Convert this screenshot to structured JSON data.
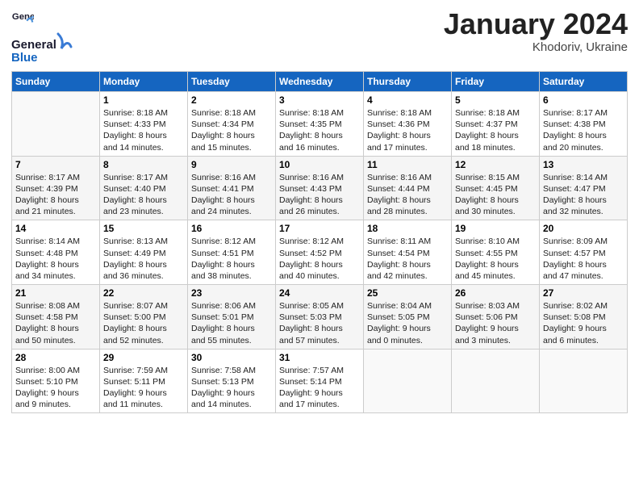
{
  "header": {
    "logo_general": "General",
    "logo_blue": "Blue",
    "month": "January 2024",
    "location": "Khodoriv, Ukraine"
  },
  "weekdays": [
    "Sunday",
    "Monday",
    "Tuesday",
    "Wednesday",
    "Thursday",
    "Friday",
    "Saturday"
  ],
  "weeks": [
    [
      {
        "day": "",
        "info": ""
      },
      {
        "day": "1",
        "info": "Sunrise: 8:18 AM\nSunset: 4:33 PM\nDaylight: 8 hours\nand 14 minutes."
      },
      {
        "day": "2",
        "info": "Sunrise: 8:18 AM\nSunset: 4:34 PM\nDaylight: 8 hours\nand 15 minutes."
      },
      {
        "day": "3",
        "info": "Sunrise: 8:18 AM\nSunset: 4:35 PM\nDaylight: 8 hours\nand 16 minutes."
      },
      {
        "day": "4",
        "info": "Sunrise: 8:18 AM\nSunset: 4:36 PM\nDaylight: 8 hours\nand 17 minutes."
      },
      {
        "day": "5",
        "info": "Sunrise: 8:18 AM\nSunset: 4:37 PM\nDaylight: 8 hours\nand 18 minutes."
      },
      {
        "day": "6",
        "info": "Sunrise: 8:17 AM\nSunset: 4:38 PM\nDaylight: 8 hours\nand 20 minutes."
      }
    ],
    [
      {
        "day": "7",
        "info": "Sunrise: 8:17 AM\nSunset: 4:39 PM\nDaylight: 8 hours\nand 21 minutes."
      },
      {
        "day": "8",
        "info": "Sunrise: 8:17 AM\nSunset: 4:40 PM\nDaylight: 8 hours\nand 23 minutes."
      },
      {
        "day": "9",
        "info": "Sunrise: 8:16 AM\nSunset: 4:41 PM\nDaylight: 8 hours\nand 24 minutes."
      },
      {
        "day": "10",
        "info": "Sunrise: 8:16 AM\nSunset: 4:43 PM\nDaylight: 8 hours\nand 26 minutes."
      },
      {
        "day": "11",
        "info": "Sunrise: 8:16 AM\nSunset: 4:44 PM\nDaylight: 8 hours\nand 28 minutes."
      },
      {
        "day": "12",
        "info": "Sunrise: 8:15 AM\nSunset: 4:45 PM\nDaylight: 8 hours\nand 30 minutes."
      },
      {
        "day": "13",
        "info": "Sunrise: 8:14 AM\nSunset: 4:47 PM\nDaylight: 8 hours\nand 32 minutes."
      }
    ],
    [
      {
        "day": "14",
        "info": "Sunrise: 8:14 AM\nSunset: 4:48 PM\nDaylight: 8 hours\nand 34 minutes."
      },
      {
        "day": "15",
        "info": "Sunrise: 8:13 AM\nSunset: 4:49 PM\nDaylight: 8 hours\nand 36 minutes."
      },
      {
        "day": "16",
        "info": "Sunrise: 8:12 AM\nSunset: 4:51 PM\nDaylight: 8 hours\nand 38 minutes."
      },
      {
        "day": "17",
        "info": "Sunrise: 8:12 AM\nSunset: 4:52 PM\nDaylight: 8 hours\nand 40 minutes."
      },
      {
        "day": "18",
        "info": "Sunrise: 8:11 AM\nSunset: 4:54 PM\nDaylight: 8 hours\nand 42 minutes."
      },
      {
        "day": "19",
        "info": "Sunrise: 8:10 AM\nSunset: 4:55 PM\nDaylight: 8 hours\nand 45 minutes."
      },
      {
        "day": "20",
        "info": "Sunrise: 8:09 AM\nSunset: 4:57 PM\nDaylight: 8 hours\nand 47 minutes."
      }
    ],
    [
      {
        "day": "21",
        "info": "Sunrise: 8:08 AM\nSunset: 4:58 PM\nDaylight: 8 hours\nand 50 minutes."
      },
      {
        "day": "22",
        "info": "Sunrise: 8:07 AM\nSunset: 5:00 PM\nDaylight: 8 hours\nand 52 minutes."
      },
      {
        "day": "23",
        "info": "Sunrise: 8:06 AM\nSunset: 5:01 PM\nDaylight: 8 hours\nand 55 minutes."
      },
      {
        "day": "24",
        "info": "Sunrise: 8:05 AM\nSunset: 5:03 PM\nDaylight: 8 hours\nand 57 minutes."
      },
      {
        "day": "25",
        "info": "Sunrise: 8:04 AM\nSunset: 5:05 PM\nDaylight: 9 hours\nand 0 minutes."
      },
      {
        "day": "26",
        "info": "Sunrise: 8:03 AM\nSunset: 5:06 PM\nDaylight: 9 hours\nand 3 minutes."
      },
      {
        "day": "27",
        "info": "Sunrise: 8:02 AM\nSunset: 5:08 PM\nDaylight: 9 hours\nand 6 minutes."
      }
    ],
    [
      {
        "day": "28",
        "info": "Sunrise: 8:00 AM\nSunset: 5:10 PM\nDaylight: 9 hours\nand 9 minutes."
      },
      {
        "day": "29",
        "info": "Sunrise: 7:59 AM\nSunset: 5:11 PM\nDaylight: 9 hours\nand 11 minutes."
      },
      {
        "day": "30",
        "info": "Sunrise: 7:58 AM\nSunset: 5:13 PM\nDaylight: 9 hours\nand 14 minutes."
      },
      {
        "day": "31",
        "info": "Sunrise: 7:57 AM\nSunset: 5:14 PM\nDaylight: 9 hours\nand 17 minutes."
      },
      {
        "day": "",
        "info": ""
      },
      {
        "day": "",
        "info": ""
      },
      {
        "day": "",
        "info": ""
      }
    ]
  ]
}
